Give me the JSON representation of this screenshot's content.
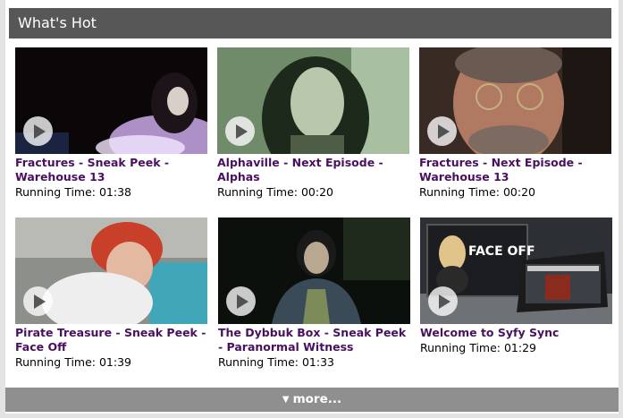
{
  "header": {
    "title": "What's Hot"
  },
  "videos": [
    {
      "title": "Fractures - Sneak Peek - Warehouse 13",
      "running_time": "Running Time: 01:38"
    },
    {
      "title": "Alphaville - Next Episode - Alphas",
      "running_time": "Running Time: 00:20"
    },
    {
      "title": "Fractures - Next Episode - Warehouse 13",
      "running_time": "Running Time: 00:20"
    },
    {
      "title": "Pirate Treasure - Sneak Peek - Face Off",
      "running_time": "Running Time: 01:39"
    },
    {
      "title": "The Dybbuk Box - Sneak Peek - Paranormal Witness",
      "running_time": "Running Time: 01:33"
    },
    {
      "title": "Welcome to Syfy Sync",
      "running_time": "Running Time: 01:29"
    }
  ],
  "thumb_overlay_text": {
    "faceoff_logo": "FACE OFF"
  },
  "more_button": {
    "arrow_icon": "triangle-down-icon",
    "label": "more..."
  },
  "colors": {
    "header_bg": "#575757",
    "title_color": "#4a1060",
    "more_bg": "#8f8f8f"
  }
}
